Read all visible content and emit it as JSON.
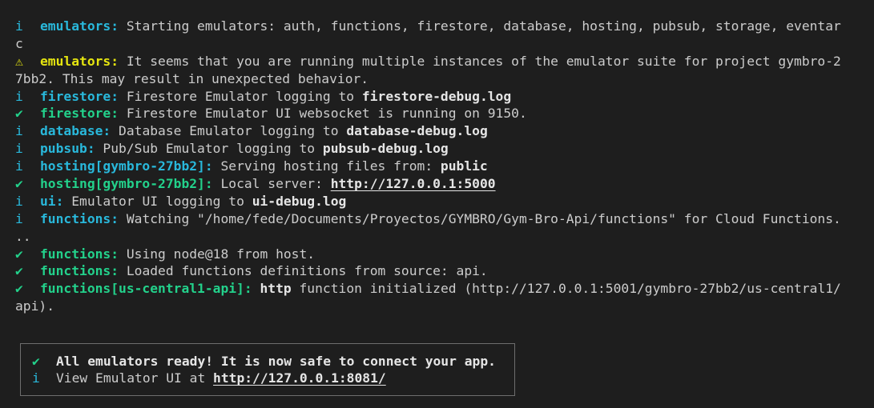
{
  "terminal": {
    "background": "#1e1e1e",
    "foreground": "#cccccc",
    "colors": {
      "info": "#29b8db",
      "success": "#23d18b",
      "warning": "#e5e510"
    },
    "icons": {
      "info": "i",
      "success": "✔",
      "warning": "⚠"
    },
    "lines": {
      "l1": {
        "tag": "emulators:",
        "text": " Starting emulators: auth, functions, firestore, database, hosting, pubsub, storage, eventar",
        "wrap": "c"
      },
      "l2": {
        "tag": "emulators:",
        "text": " It seems that you are running multiple instances of the emulator suite for project gymbro-2",
        "wrap": "7bb2. This may result in unexpected behavior."
      },
      "l3": {
        "tag": "firestore:",
        "text": " Firestore Emulator logging to ",
        "bold": "firestore-debug.log"
      },
      "l4": {
        "tag": "firestore:",
        "text": " Firestore Emulator UI websocket is running on 9150."
      },
      "l5": {
        "tag": "database:",
        "text": " Database Emulator logging to ",
        "bold": "database-debug.log"
      },
      "l6": {
        "tag": "pubsub:",
        "text": " Pub/Sub Emulator logging to ",
        "bold": "pubsub-debug.log"
      },
      "l7": {
        "tag": "hosting[gymbro-27bb2]:",
        "text": " Serving hosting files from: ",
        "bold": "public"
      },
      "l8": {
        "tag": "hosting[gymbro-27bb2]:",
        "text": " Local server: ",
        "link": "http://127.0.0.1:5000"
      },
      "l9": {
        "tag": "ui:",
        "text": " Emulator UI logging to ",
        "bold": "ui-debug.log"
      },
      "l10": {
        "tag": "functions:",
        "text": " Watching \"/home/fede/Documents/Proyectos/GYMBRO/Gym-Bro-Api/functions\" for Cloud Functions.",
        "wrap": ".."
      },
      "l11": {
        "tag": "functions:",
        "text": " Using node@18 from host."
      },
      "l12": {
        "tag": "functions:",
        "text": " Loaded functions definitions from source: api."
      },
      "l13": {
        "tag": "functions[us-central1-api]:",
        "bold": "http",
        "text": " function initialized (http://127.0.0.1:5001/gymbro-27bb2/us-central1/",
        "wrap": "api)."
      }
    },
    "ready_box": {
      "line1": "All emulators ready! It is now safe to connect your app.",
      "line2_prefix": "View Emulator UI at ",
      "line2_link": "http://127.0.0.1:8081/"
    }
  }
}
